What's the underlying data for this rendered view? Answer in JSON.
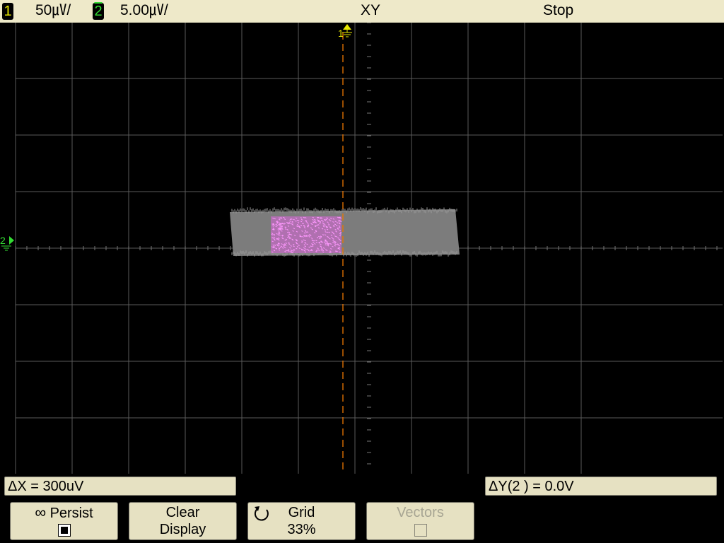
{
  "status_bar": {
    "ch1_number": "1",
    "ch1_scale": "50㎶/",
    "ch2_number": "2",
    "ch2_scale": "5.00㎶/",
    "mode": "XY",
    "run_state": "Stop"
  },
  "graticule": {
    "ch1_marker": "1",
    "ch2_marker": "2",
    "colors": {
      "background": "#000000",
      "grid": "#555555",
      "trace_gray": "#808080",
      "trace_pink": "#ee88ee",
      "cursor": "#ee7700",
      "ch1": "#e8e800",
      "ch2": "#33dd33"
    }
  },
  "readouts": {
    "delta_x": "ΔX = 300uV",
    "delta_y": "ΔY(2 ) = 0.0V"
  },
  "softkeys": [
    {
      "line1": "Persist",
      "icon": "infinity-icon",
      "checked": true,
      "enabled": true
    },
    {
      "line1": "Clear",
      "line2": "Display",
      "enabled": true
    },
    {
      "line1": "Grid",
      "line2": "33%",
      "icon": "rotate-knob-icon",
      "enabled": true
    },
    {
      "line1": "Vectors",
      "checked": false,
      "enabled": false
    }
  ]
}
